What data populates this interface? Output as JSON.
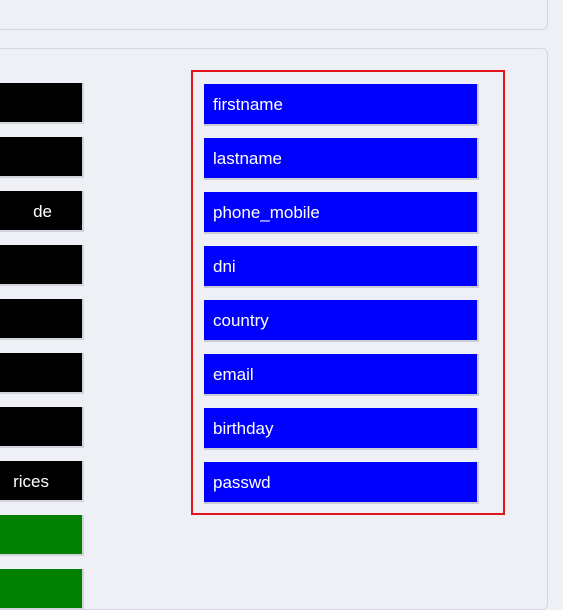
{
  "left_items": [
    {
      "label": "",
      "color": "#000000"
    },
    {
      "label": "",
      "color": "#000000"
    },
    {
      "label": "de",
      "color": "#000000"
    },
    {
      "label": "",
      "color": "#000000"
    },
    {
      "label": "",
      "color": "#000000"
    },
    {
      "label": "",
      "color": "#000000"
    },
    {
      "label": "",
      "color": "#000000"
    },
    {
      "label": "rices",
      "color": "#000000"
    },
    {
      "label": "",
      "color": "#008000"
    },
    {
      "label": "",
      "color": "#008000"
    }
  ],
  "selected_fields": [
    {
      "label": "firstname"
    },
    {
      "label": "lastname"
    },
    {
      "label": "phone_mobile"
    },
    {
      "label": "dni"
    },
    {
      "label": "country"
    },
    {
      "label": "email"
    },
    {
      "label": "birthday"
    },
    {
      "label": "passwd"
    }
  ],
  "colors": {
    "background": "#eef0f6",
    "field_blue": "#0000ff",
    "left_black": "#000000",
    "left_green": "#008000",
    "drop_zone_border": "#e1141a"
  }
}
